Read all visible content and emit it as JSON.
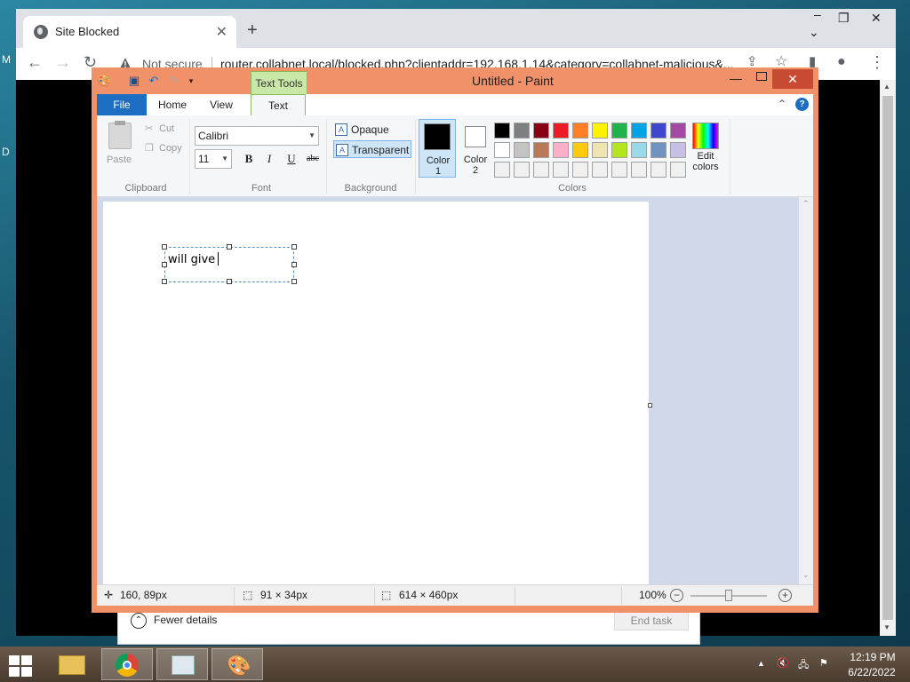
{
  "browser": {
    "tab_title": "Site Blocked",
    "tab_close": "✕",
    "new_tab": "+",
    "security_status": "Not secure",
    "url": "router.collabnet.local/blocked.php?clientaddr=192.168.1.14&category=collabnet-malicious&..."
  },
  "desktop": {
    "edge_letters": [
      "M",
      "D"
    ]
  },
  "paint": {
    "window_title": "Untitled - Paint",
    "contextual_tab": "Text Tools",
    "tabs": [
      "File",
      "Home",
      "View",
      "Text"
    ],
    "clipboard": {
      "group_label": "Clipboard",
      "paste": "Paste",
      "cut": "Cut",
      "copy": "Copy"
    },
    "font": {
      "group_label": "Font",
      "family": "Calibri",
      "size": "11",
      "bold": "B",
      "italic": "I",
      "underline": "U",
      "strikethrough": "abc"
    },
    "background": {
      "group_label": "Background",
      "opaque": "Opaque",
      "transparent": "Transparent",
      "selected": "Transparent"
    },
    "colors": {
      "group_label": "Colors",
      "color1_label_a": "Color",
      "color1_label_b": "1",
      "color2_label_a": "Color",
      "color2_label_b": "2",
      "color1_value": "#000000",
      "color2_value": "#ffffff",
      "edit_label_a": "Edit",
      "edit_label_b": "colors",
      "palette_row1": [
        "#000000",
        "#7f7f7f",
        "#880015",
        "#ed1c24",
        "#ff7f27",
        "#fff200",
        "#22b14c",
        "#00a2e8",
        "#3f48cc",
        "#a349a4"
      ],
      "palette_row2": [
        "#ffffff",
        "#c3c3c3",
        "#b97a57",
        "#ffaec9",
        "#ffc90e",
        "#efe4b0",
        "#b5e61d",
        "#99d9ea",
        "#7092be",
        "#c8bfe7"
      ],
      "palette_row3": [
        "#f0f0f0",
        "#f0f0f0",
        "#f0f0f0",
        "#f0f0f0",
        "#f0f0f0",
        "#f0f0f0",
        "#f0f0f0",
        "#f0f0f0",
        "#f0f0f0",
        "#f0f0f0"
      ]
    },
    "canvas_text": "will give",
    "status": {
      "cursor_pos": "160, 89px",
      "selection_size": "91 × 34px",
      "image_size": "614 × 460px",
      "zoom": "100%"
    }
  },
  "task_manager": {
    "fewer_details": "Fewer details",
    "end_task": "End task"
  },
  "taskbar": {
    "time": "12:19 PM",
    "date": "6/22/2022"
  }
}
